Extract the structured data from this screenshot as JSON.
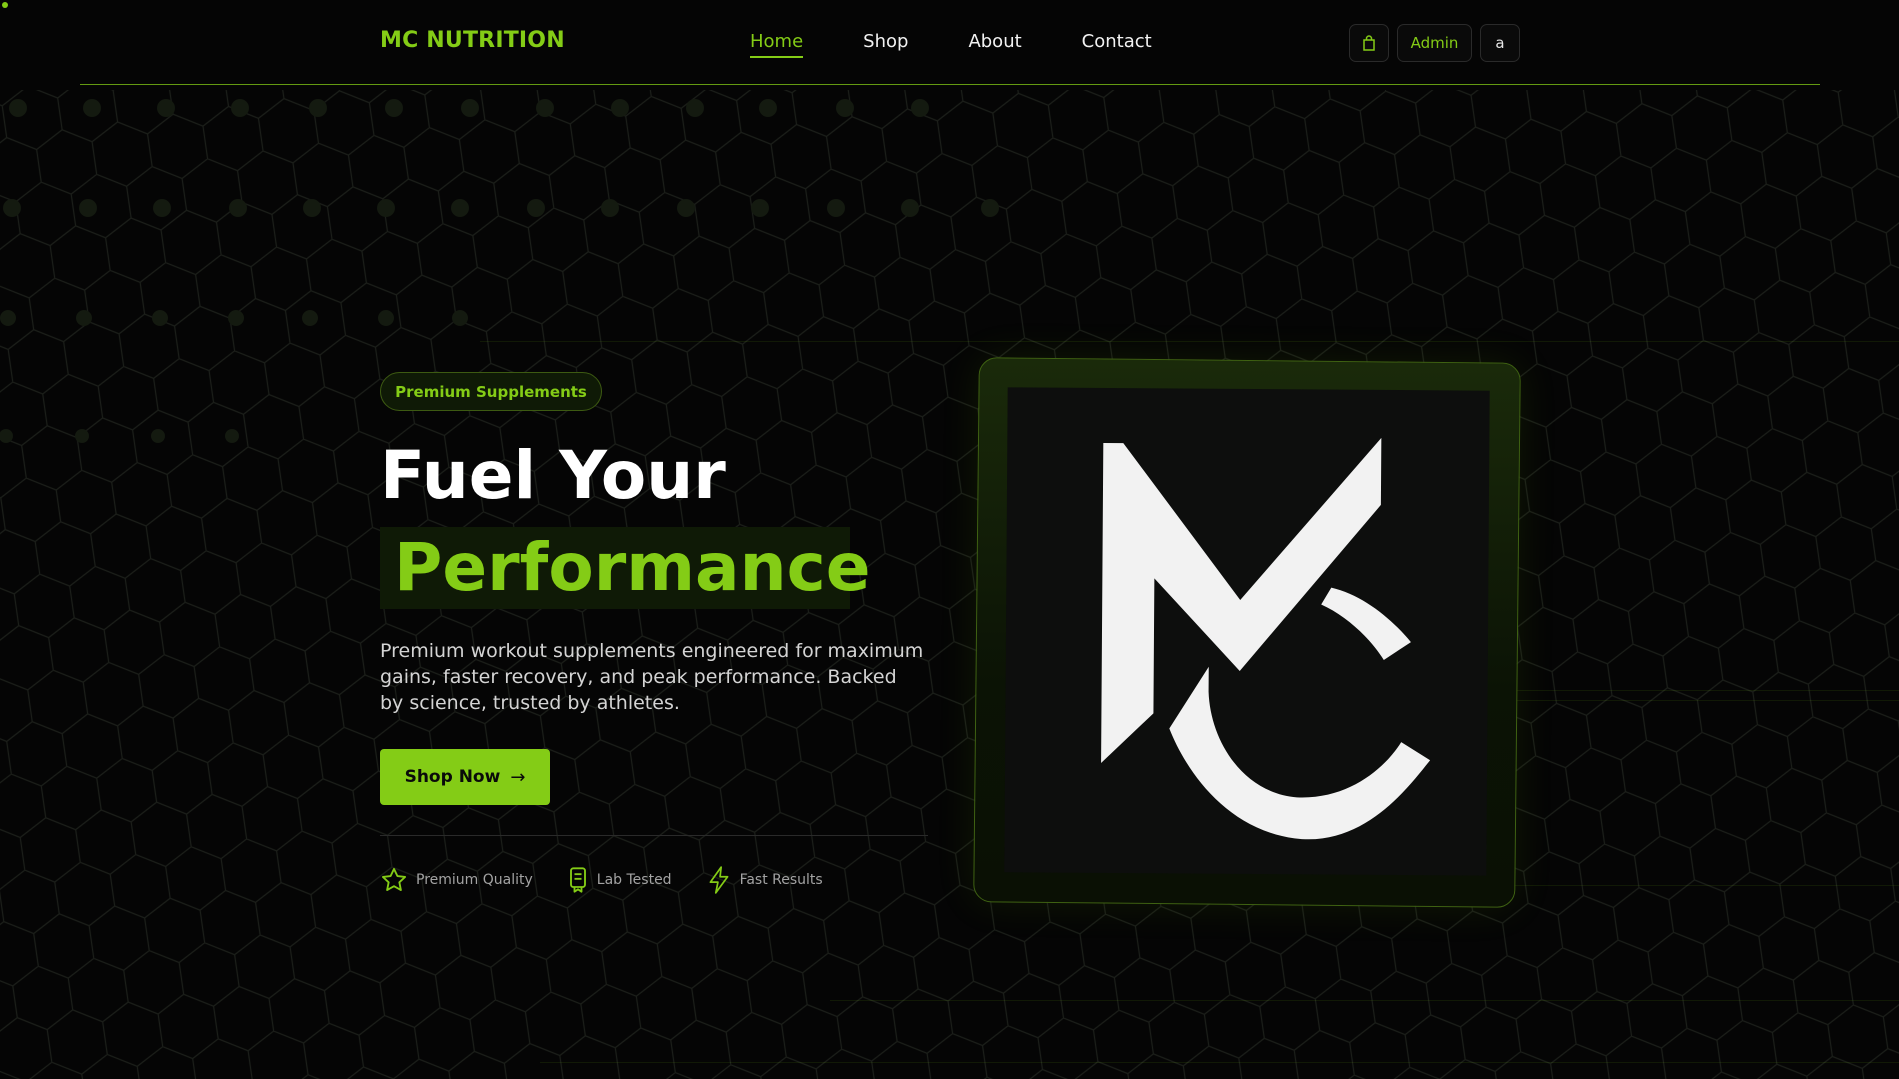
{
  "header": {
    "brand": "MC NUTRITION",
    "nav": [
      "Home",
      "Shop",
      "About",
      "Contact"
    ],
    "active_nav": "Home",
    "cart_icon": "shopping-bag-icon",
    "admin_label": "Admin",
    "user_initial": "a"
  },
  "hero": {
    "badge": "Premium Supplements",
    "title_line1": "Fuel Your",
    "title_line2": "Performance",
    "description": "Premium workout supplements engineered for maximum gains, faster recovery, and peak performance. Backed by science, trusted by athletes.",
    "cta_label": "Shop Now",
    "cta_arrow": "→",
    "features": [
      {
        "label": "Premium Quality",
        "icon": "star-icon"
      },
      {
        "label": "Lab Tested",
        "icon": "certificate-icon"
      },
      {
        "label": "Fast Results",
        "icon": "lightning-icon"
      }
    ],
    "logo": "MC logo"
  },
  "colors": {
    "accent": "#84cc16",
    "background": "#050505",
    "text": "#ffffff"
  }
}
